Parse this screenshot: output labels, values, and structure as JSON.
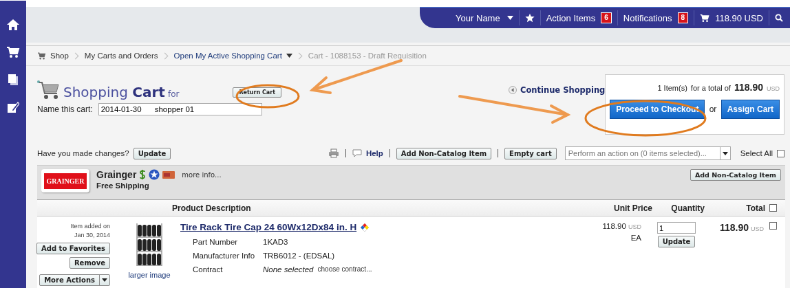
{
  "topbar": {
    "user_name": "Your Name",
    "items": [
      {
        "label": "Action Items",
        "count": "6"
      },
      {
        "label": "Notifications",
        "count": "8"
      }
    ],
    "cart_total": "118.90 USD"
  },
  "breadcrumbs": [
    {
      "label": "Shop",
      "kind": "shop"
    },
    {
      "label": "My Carts and Orders",
      "kind": "link"
    },
    {
      "label": "Open My Active Shopping Cart",
      "kind": "dropdown"
    },
    {
      "label": "Cart - 1088153 - Draft Requisition",
      "kind": "current"
    }
  ],
  "cart": {
    "title_light": "Shopping",
    "title_bold": "Cart",
    "title_suffix": "for",
    "return_button": "Return Cart",
    "name_label": "Name this cart:",
    "name_value": "2014-01-30      shopper 01",
    "continue_link": "Continue Shopping"
  },
  "summary": {
    "items": "1 Item(s)",
    "for_total": "for a total of",
    "total": "118.90",
    "currency": "USD",
    "checkout_button": "Proceed to Checkout",
    "or": "or",
    "assign_button": "Assign Cart"
  },
  "toolbar": {
    "changes_label": "Have you made changes?",
    "update_button": "Update",
    "help": "Help",
    "add_noncatalog": "Add Non-Catalog Item",
    "empty_cart": "Empty cart",
    "action_placeholder": "Perform an action on (0 items selected)...",
    "select_all": "Select All",
    "select_all_checked": false
  },
  "supplier": {
    "logo": "GRAINGER",
    "name": "Grainger",
    "more_info": "more info...",
    "shipping": "Free Shipping",
    "add_noncatalog": "Add Non-Catalog Item"
  },
  "columns": [
    "Product Description",
    "Unit Price",
    "Quantity",
    "Total"
  ],
  "total_checked": false,
  "items": [
    {
      "added_label": "Item added on",
      "added_date": "Jan 30, 2014",
      "add_favorites": "Add to Favorites",
      "remove": "Remove",
      "more_actions": "More Actions",
      "image_link": "larger image",
      "title": "Tire Rack Tire Cap 24 60Wx12Dx84 in. H",
      "details": [
        {
          "label": "Part Number",
          "value": "1KAD3"
        },
        {
          "label": "Manufacturer Info",
          "value": "TRB6012 - (EDSAL)"
        },
        {
          "label": "Contract",
          "value": "None selected",
          "action": "choose contract..."
        }
      ],
      "unit_price": "118.90",
      "unit_currency": "USD",
      "unit": "EA",
      "quantity": "1",
      "update": "Update",
      "total": "118.90",
      "total_currency": "USD",
      "checked": false
    }
  ]
}
